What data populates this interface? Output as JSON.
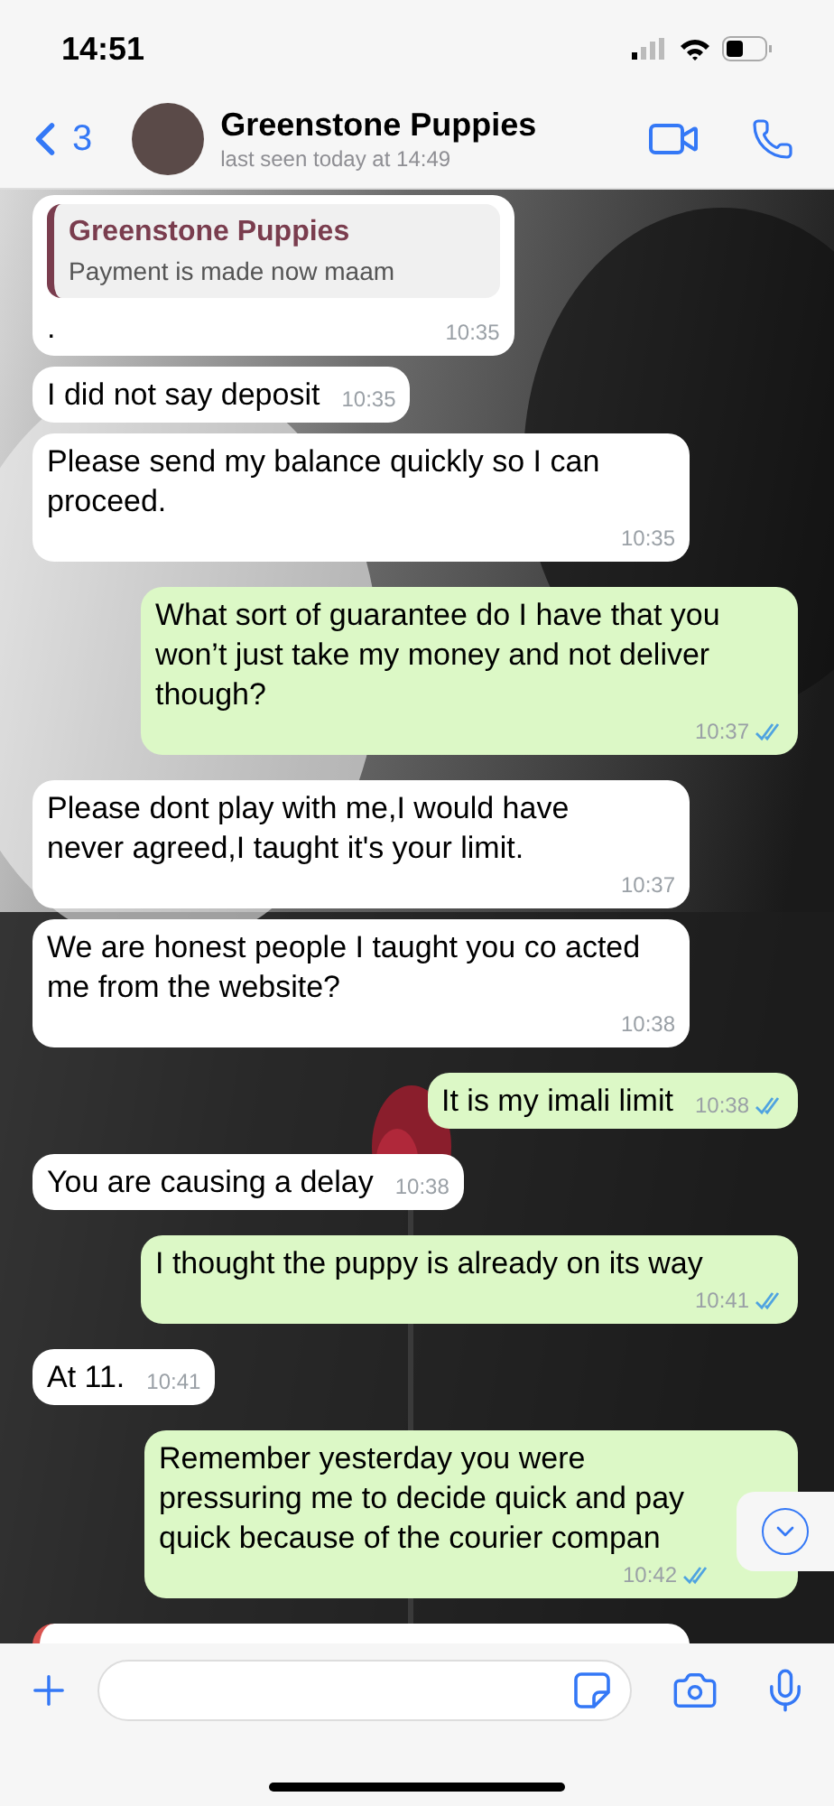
{
  "status_bar": {
    "time": "14:51"
  },
  "header": {
    "back_count": "3",
    "name": "Greenstone Puppies",
    "subtitle": "last seen today at 14:49"
  },
  "messages": [
    {
      "kind": "reply",
      "outgoing": false,
      "quote_name": "Greenstone Puppies",
      "quote_text": "Payment is made now maam",
      "text": ".",
      "time": "10:35"
    },
    {
      "kind": "text",
      "outgoing": false,
      "text": "I did not say deposit",
      "time": "10:35"
    },
    {
      "kind": "text",
      "outgoing": false,
      "text": "Please send my balance quickly so I can proceed.",
      "time": "10:35"
    },
    {
      "kind": "text",
      "outgoing": true,
      "text": "What sort of guarantee do I have that you won’t just take my money and not deliver though?",
      "time": "10:37",
      "read": true
    },
    {
      "kind": "text",
      "outgoing": false,
      "text": "Please dont play with me,I would have never agreed,I taught it's your limit.",
      "time": "10:37"
    },
    {
      "kind": "text",
      "outgoing": false,
      "text": "We are honest people I taught you co acted me from the website?",
      "time": "10:38"
    },
    {
      "kind": "text",
      "outgoing": true,
      "text": "It is my imali limit",
      "time": "10:38",
      "read": true
    },
    {
      "kind": "text",
      "outgoing": false,
      "text": "You are causing a delay",
      "time": "10:38"
    },
    {
      "kind": "text",
      "outgoing": true,
      "text": "I thought the puppy is already on its way",
      "time": "10:41",
      "read": true
    },
    {
      "kind": "text",
      "outgoing": false,
      "text": "At 11.",
      "time": "10:41"
    },
    {
      "kind": "text",
      "outgoing": true,
      "text": "Remember yesterday you were pressuring me to decide quick and pay quick because of the courier compan",
      "time": "10:42",
      "read": true
    }
  ]
}
